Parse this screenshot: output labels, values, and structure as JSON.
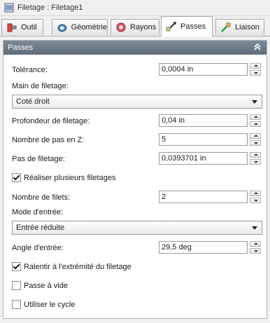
{
  "window": {
    "title": "Filetage : Filetage1"
  },
  "tabs": [
    {
      "label": "Outil",
      "icon": "tool-icon"
    },
    {
      "label": "Géométrie",
      "icon": "geometry-icon"
    },
    {
      "label": "Rayons",
      "icon": "radii-icon"
    },
    {
      "label": "Passes",
      "icon": "passes-icon",
      "active": true
    },
    {
      "label": "Liaison",
      "icon": "linking-icon"
    }
  ],
  "panel": {
    "title": "Passes",
    "tolerance": {
      "label": "Tolérance:",
      "value": "0,0004 in"
    },
    "hand": {
      "label": "Main de filetage:",
      "value": "Coté droit"
    },
    "depth": {
      "label": "Profondeur de filetage:",
      "value": "0,04 in"
    },
    "z_passes": {
      "label": "Nombre de pas en Z:",
      "value": "5"
    },
    "pitch": {
      "label": "Pas de filetage:",
      "value": "0,0393701 in"
    },
    "multiple": {
      "label": "Réaliser plusieurs filetages",
      "checked": true
    },
    "thread_count": {
      "label": "Nombre de filets:",
      "value": "2"
    },
    "infeed_mode": {
      "label": "Mode d'entrée:",
      "value": "Entrée réduite"
    },
    "infeed_angle": {
      "label": "Angle d'entrée:",
      "value": "29,5 deg"
    },
    "slow_end": {
      "label": "Ralentir à l'extrémité du filetage",
      "checked": true
    },
    "spring_pass": {
      "label": "Passe à vide",
      "checked": false
    },
    "use_cycle": {
      "label": "Utiliser le cycle",
      "checked": false
    }
  }
}
